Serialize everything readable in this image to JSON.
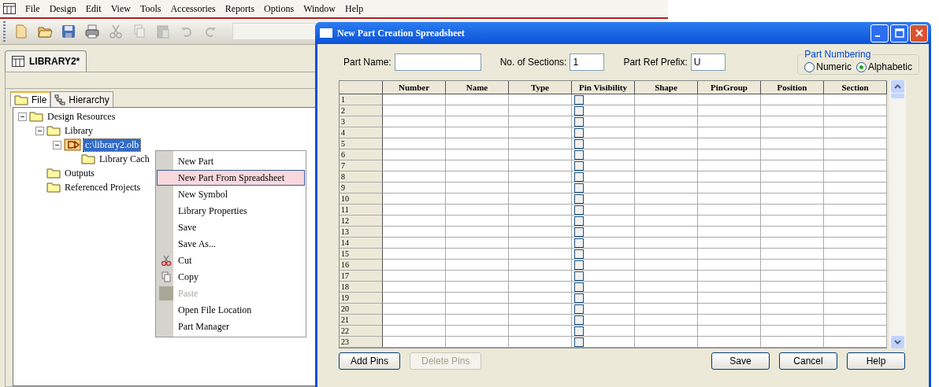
{
  "menu_bar": [
    "File",
    "Design",
    "Edit",
    "View",
    "Tools",
    "Accessories",
    "Reports",
    "Options",
    "Window",
    "Help"
  ],
  "toolbar": [
    {
      "kind": "new",
      "disabled": false
    },
    {
      "kind": "open",
      "disabled": false
    },
    {
      "kind": "save",
      "disabled": false
    },
    {
      "kind": "print",
      "disabled": false
    },
    {
      "kind": "cut",
      "disabled": true
    },
    {
      "kind": "copy",
      "disabled": true
    },
    {
      "kind": "paste",
      "disabled": true
    },
    {
      "kind": "undo",
      "disabled": true
    },
    {
      "kind": "redo",
      "disabled": true
    }
  ],
  "document_tab": {
    "label": "LIBRARY2*"
  },
  "panel_tabs": [
    {
      "label": "File",
      "kind": "file",
      "selected": true
    },
    {
      "label": "Hierarchy",
      "kind": "hierarchy",
      "selected": false
    }
  ],
  "tree": [
    {
      "label": "Design Resources",
      "kind": "folder",
      "expanded": true,
      "selected": false,
      "children": [
        {
          "label": "Library",
          "kind": "folder",
          "expanded": true,
          "selected": false,
          "children": [
            {
              "label": "c:\\library2.olb",
              "kind": "library",
              "expanded": true,
              "selected": true,
              "children": [
                {
                  "label": "Library Cach",
                  "kind": "folder",
                  "selected": false
                }
              ]
            }
          ]
        },
        {
          "label": "Outputs",
          "kind": "folder",
          "selected": false
        },
        {
          "label": "Referenced Projects",
          "kind": "folder",
          "selected": false
        }
      ]
    }
  ],
  "context_menu": [
    {
      "label": "New Part",
      "kind": "plain",
      "selected": false,
      "disabled": false
    },
    {
      "label": "New Part From Spreadsheet",
      "kind": "plain",
      "selected": true,
      "disabled": false
    },
    {
      "label": "New Symbol",
      "kind": "plain",
      "selected": false,
      "disabled": false
    },
    {
      "label": "Library Properties",
      "kind": "plain",
      "selected": false,
      "disabled": false
    },
    {
      "label": "Save",
      "kind": "plain",
      "selected": false,
      "disabled": false
    },
    {
      "label": "Save As...",
      "kind": "plain",
      "selected": false,
      "disabled": false
    },
    {
      "label": "Cut",
      "kind": "cut",
      "selected": false,
      "disabled": false
    },
    {
      "label": "Copy",
      "kind": "copy",
      "selected": false,
      "disabled": false
    },
    {
      "label": "Paste",
      "kind": "paste",
      "selected": false,
      "disabled": true
    },
    {
      "label": "Open File Location",
      "kind": "plain",
      "selected": false,
      "disabled": false
    },
    {
      "label": "Part Manager",
      "kind": "plain",
      "selected": false,
      "disabled": false
    }
  ],
  "dialog": {
    "title": "New Part Creation Spreadsheet",
    "part_name": {
      "label": "Part Name:"
    },
    "sections": {
      "label": "No. of Sections:",
      "value": "1"
    },
    "prefix": {
      "label": "Part Ref Prefix:",
      "value": "U"
    },
    "part_numbering": {
      "title": "Part Numbering",
      "options": [
        {
          "label": "Numeric",
          "selected": false
        },
        {
          "label": "Alphabetic",
          "selected": true
        }
      ]
    },
    "columns": [
      "Number",
      "Name",
      "Type",
      "Pin Visibility",
      "Shape",
      "PinGroup",
      "Position",
      "Section"
    ],
    "rows": [
      {
        "label": "1",
        "pin_visibility": false
      },
      {
        "label": "2",
        "pin_visibility": false
      },
      {
        "label": "3",
        "pin_visibility": false
      },
      {
        "label": "4",
        "pin_visibility": false
      },
      {
        "label": "5",
        "pin_visibility": false
      },
      {
        "label": "6",
        "pin_visibility": false
      },
      {
        "label": "7",
        "pin_visibility": false
      },
      {
        "label": "8",
        "pin_visibility": false
      },
      {
        "label": "9",
        "pin_visibility": false
      },
      {
        "label": "10",
        "pin_visibility": false
      },
      {
        "label": "11",
        "pin_visibility": false
      },
      {
        "label": "12",
        "pin_visibility": false
      },
      {
        "label": "13",
        "pin_visibility": false
      },
      {
        "label": "14",
        "pin_visibility": false
      },
      {
        "label": "15",
        "pin_visibility": false
      },
      {
        "label": "16",
        "pin_visibility": false
      },
      {
        "label": "17",
        "pin_visibility": false
      },
      {
        "label": "18",
        "pin_visibility": false
      },
      {
        "label": "19",
        "pin_visibility": false
      },
      {
        "label": "20",
        "pin_visibility": false
      },
      {
        "label": "21",
        "pin_visibility": false
      },
      {
        "label": "22",
        "pin_visibility": false
      },
      {
        "label": "23",
        "pin_visibility": false
      }
    ],
    "buttons": [
      {
        "label": "Add Pins",
        "disabled": false
      },
      {
        "label": "Delete Pins",
        "disabled": true
      },
      {
        "label": "Save",
        "disabled": false
      },
      {
        "label": "Cancel",
        "disabled": false
      },
      {
        "label": "Help",
        "disabled": false
      }
    ]
  }
}
